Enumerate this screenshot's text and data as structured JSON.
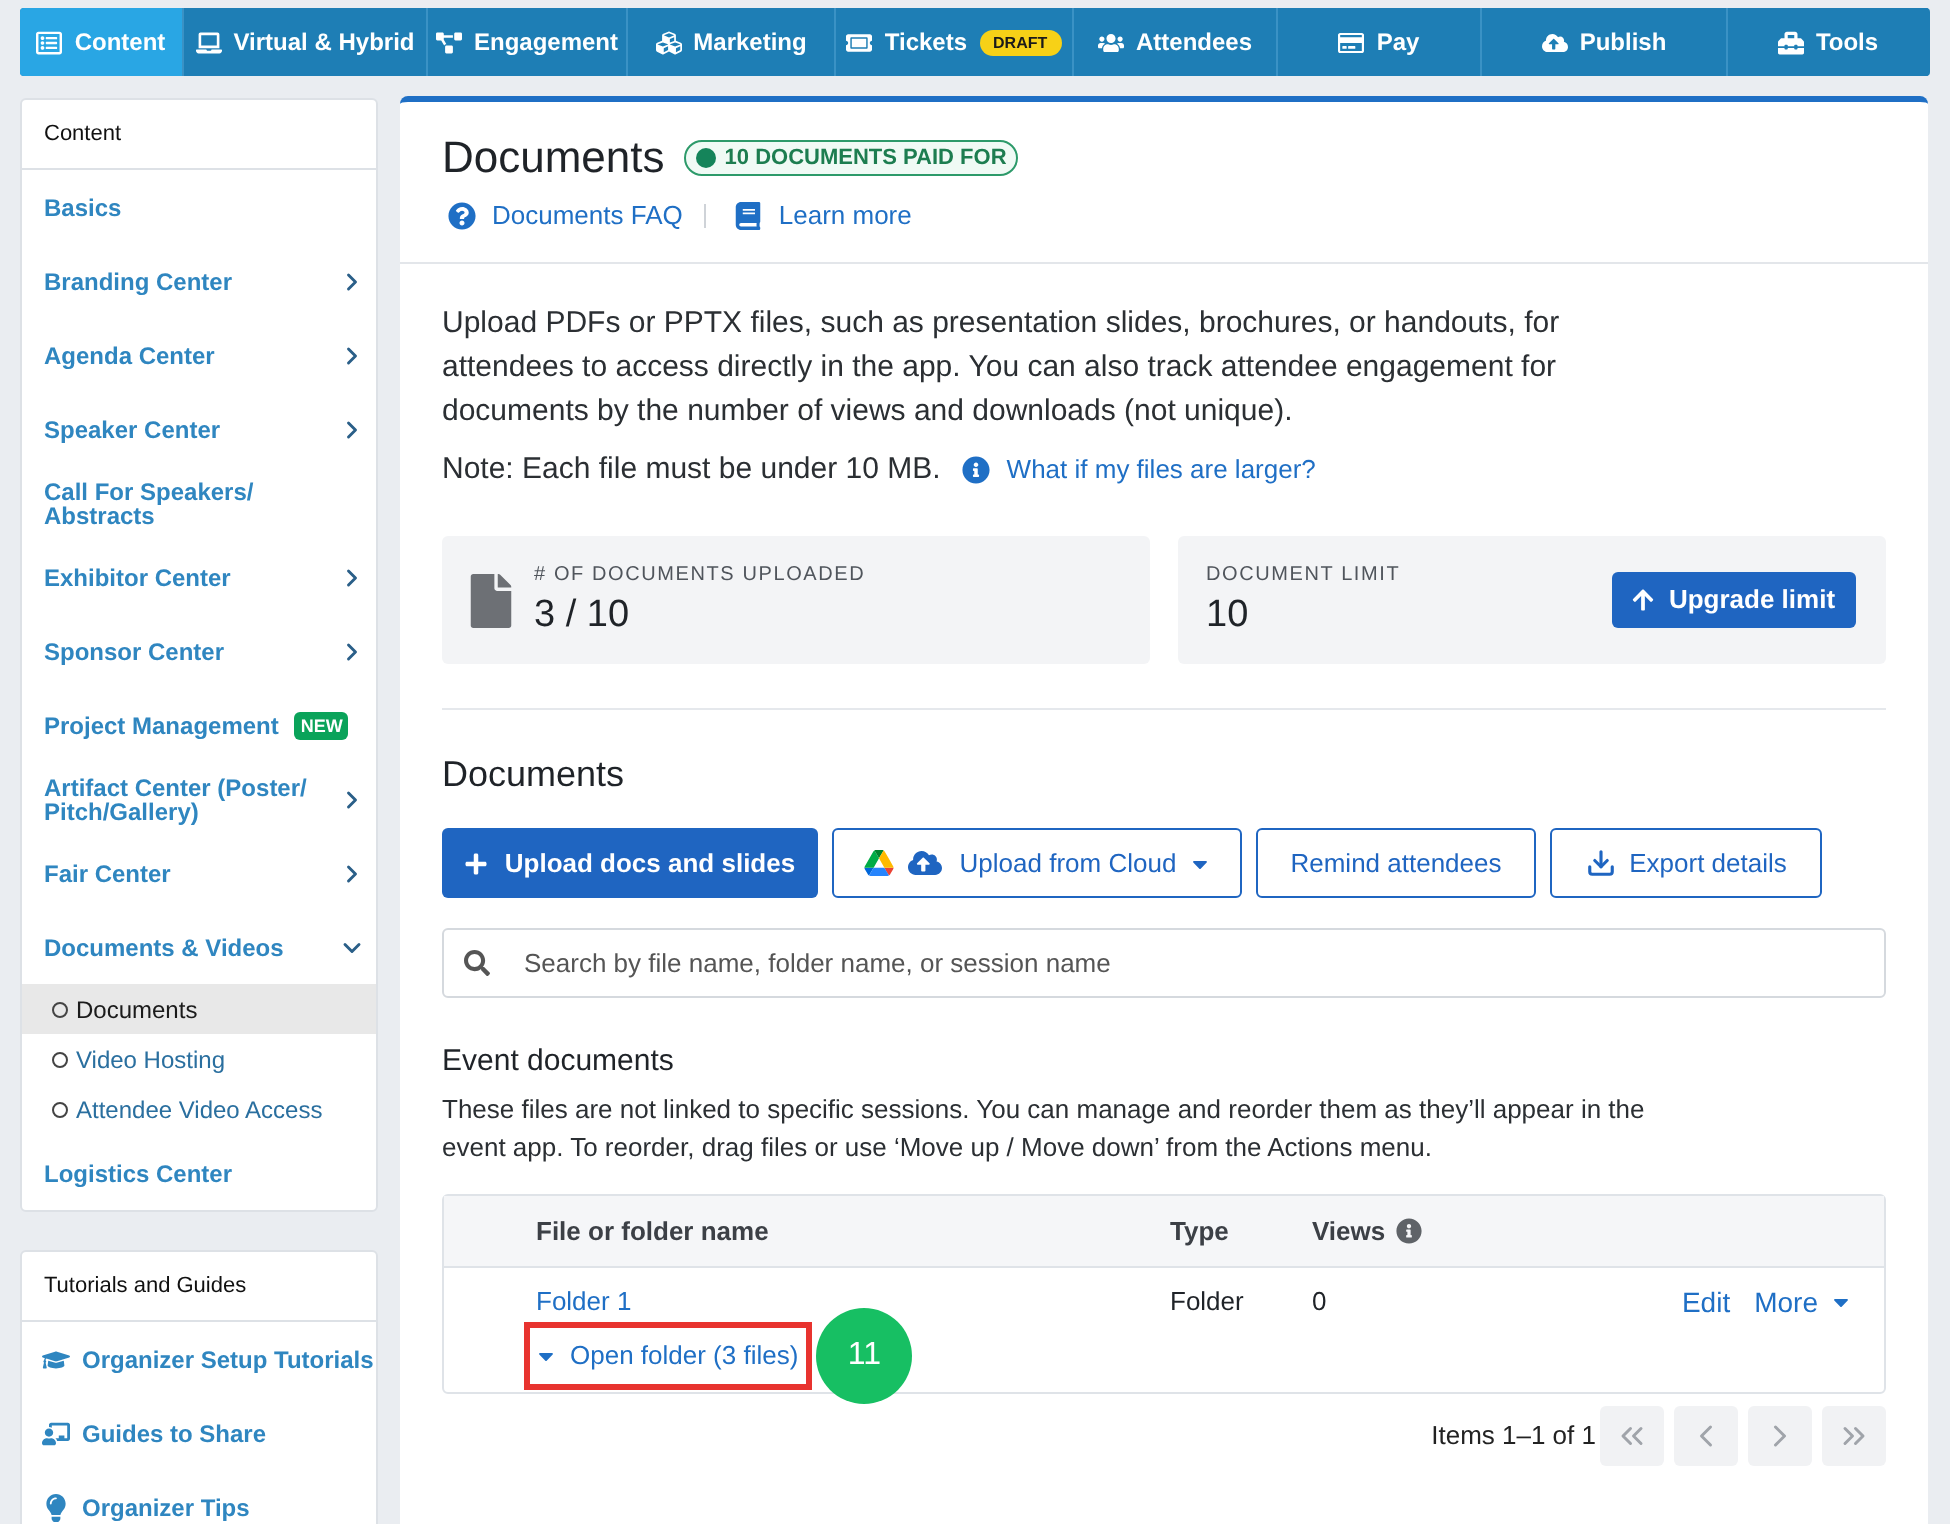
{
  "nav": {
    "tabs": [
      {
        "label": "Content",
        "selected": true
      },
      {
        "label": "Virtual & Hybrid",
        "selected": false
      },
      {
        "label": "Engagement",
        "selected": false
      },
      {
        "label": "Marketing",
        "selected": false
      },
      {
        "label": "Tickets",
        "selected": false,
        "badge": "DRAFT"
      },
      {
        "label": "Attendees",
        "selected": false
      },
      {
        "label": "Pay",
        "selected": false
      },
      {
        "label": "Publish",
        "selected": false
      },
      {
        "label": "Tools",
        "selected": false
      }
    ]
  },
  "sidebar": {
    "sections": [
      {
        "kind": "menu",
        "title": "Content",
        "items": [
          {
            "label": "Basics"
          },
          {
            "label": "Branding Center",
            "expanded": false
          },
          {
            "label": "Agenda Center",
            "expanded": false
          },
          {
            "label": "Speaker Center",
            "expanded": false
          },
          {
            "label": "Call For Speakers/ Abstracts"
          },
          {
            "label": "Exhibitor Center",
            "expanded": false
          },
          {
            "label": "Sponsor Center",
            "expanded": false
          },
          {
            "label": "Project Management",
            "badge": "NEW"
          },
          {
            "label": "Artifact Center (Poster/ Pitch/Gallery)",
            "expanded": false
          },
          {
            "label": "Fair Center",
            "expanded": false
          },
          {
            "label": "Documents & Videos",
            "expanded": true,
            "children": [
              {
                "label": "Documents",
                "selected": true
              },
              {
                "label": "Video Hosting",
                "selected": false
              },
              {
                "label": "Attendee Video Access",
                "selected": false
              }
            ]
          },
          {
            "label": "Logistics Center"
          }
        ]
      },
      {
        "kind": "guides",
        "title": "Tutorials and Guides",
        "items": [
          {
            "label": "Organizer Setup Tutorials"
          },
          {
            "label": "Guides to Share"
          },
          {
            "label": "Organizer Tips"
          }
        ]
      }
    ]
  },
  "header": {
    "title": "Documents",
    "badge": "10 DOCUMENTS PAID FOR",
    "links": [
      {
        "label": "Documents FAQ"
      },
      {
        "label": "Learn more"
      }
    ]
  },
  "intro": {
    "text": "Upload PDFs or PPTX files, such as presentation slides, brochures, or handouts, for attendees to access directly in the app. You can also track attendee engagement for documents by the number of views and downloads (not unique).",
    "note": "Note: Each file must be under 10 MB.",
    "note_link": "What if my files are larger?"
  },
  "stats": [
    {
      "kind": "usage",
      "label": "# OF DOCUMENTS UPLOADED",
      "value": "3 / 10"
    },
    {
      "kind": "limit",
      "label": "DOCUMENT LIMIT",
      "value": "10",
      "button": "Upgrade limit"
    }
  ],
  "documents": {
    "heading": "Documents",
    "buttons": [
      {
        "kind": "primary",
        "label": "Upload docs and slides"
      },
      {
        "kind": "cloud",
        "label": "Upload from Cloud"
      },
      {
        "kind": "outline",
        "label": "Remind attendees"
      },
      {
        "kind": "export",
        "label": "Export details"
      }
    ],
    "search": {
      "placeholder": "Search by file name, folder name, or session name"
    },
    "section_title": "Event documents",
    "section_text": "These files are not linked to specific sessions. You can manage and reorder them as they’ll appear in the event app. To reorder, drag files or use ‘Move up / Move down’ from the Actions menu.",
    "table": {
      "columns": [
        {
          "label": "File or folder name"
        },
        {
          "label": "Type"
        },
        {
          "label": "Views",
          "info": true
        }
      ],
      "rows": [
        {
          "name": "Folder 1",
          "folder_link": "Open folder (3 files)",
          "highlighted": true,
          "type": "Folder",
          "views": "0",
          "actions": [
            {
              "label": "Edit"
            },
            {
              "label": "More",
              "menu": true
            }
          ]
        }
      ]
    },
    "pagination": {
      "summary": "Items 1–1 of 1"
    }
  },
  "step_marker": "11"
}
